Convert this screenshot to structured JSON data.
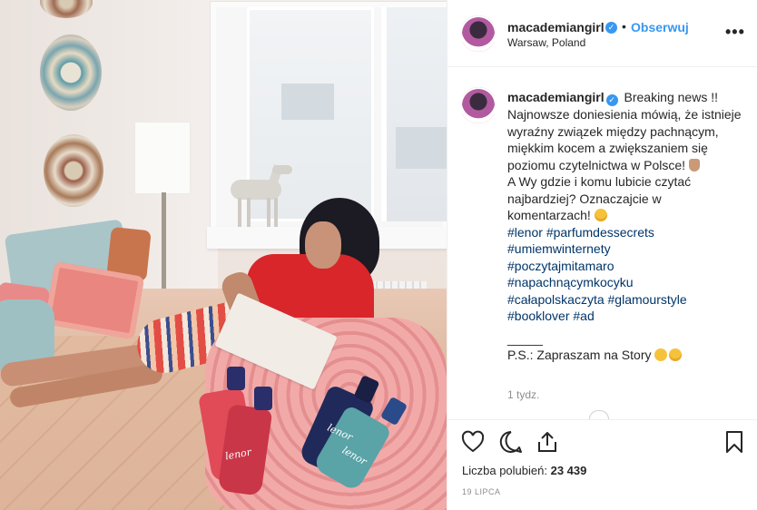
{
  "post": {
    "username": "macademiangirl",
    "follow_label": "Obserwuj",
    "separator": "•",
    "location": "Warsaw, Poland",
    "more_label": "•••"
  },
  "caption": {
    "username": "macademiangirl",
    "line1": "Breaking news !!",
    "line2": "Najnowsze doniesienia mówią, że istnieje wyraźny związek między pachnącym, miękkim kocem a zwiększaniem się poziomu czytelnictwa w Polsce!",
    "line3": "A Wy gdzie i komu lubicie czytać najbardziej? Oznaczajcie w komentarzach!",
    "hashtags": [
      "#lenor",
      "#parfumdessecrets",
      "#umiemwinternety",
      "#poczytajmitamaro",
      "#napachnącymkocyku",
      "#całapolskaczyta",
      "#glamourstyle",
      "#booklover",
      "#ad"
    ],
    "divider": "_____",
    "ps": "P.S.: Zapraszam na Story",
    "time_ago": "1 tydz."
  },
  "photo": {
    "brand_text": "lenor"
  },
  "actions": {
    "like_icon": "heart-icon",
    "comment_icon": "comment-icon",
    "share_icon": "share-icon",
    "save_icon": "bookmark-icon"
  },
  "likes": {
    "label": "Liczba polubień:",
    "count": "23 439"
  },
  "date": "19 LIPCA",
  "colors": {
    "accent_blue": "#3897f0",
    "hashtag_blue": "#003569",
    "text": "#262626",
    "muted": "#8e8e8e"
  }
}
